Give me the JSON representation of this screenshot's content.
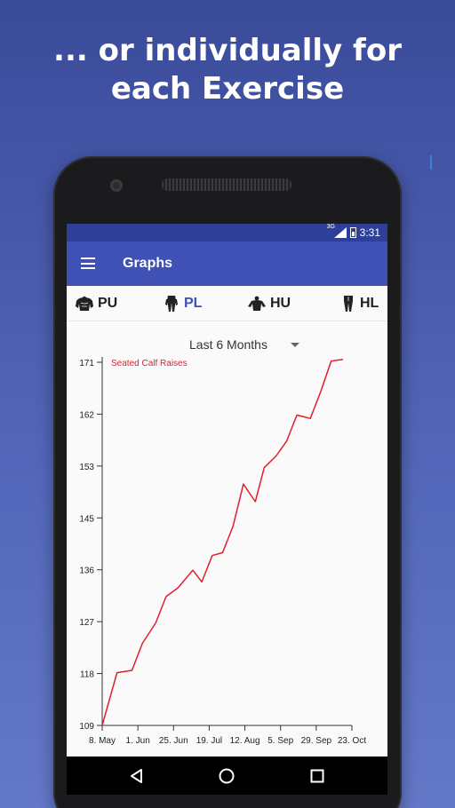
{
  "headline": {
    "line1": "... or individually for",
    "line2": "each Exercise"
  },
  "status": {
    "network": "3G",
    "time": "3:31"
  },
  "appbar": {
    "title": "Graphs"
  },
  "tabs": [
    {
      "label": "PU",
      "icon": "upper-body-front-icon"
    },
    {
      "label": "PL",
      "icon": "lower-body-front-icon",
      "active": true
    },
    {
      "label": "HU",
      "icon": "upper-body-back-icon"
    },
    {
      "label": "HL",
      "icon": "lower-body-back-icon"
    }
  ],
  "range_selector": {
    "value": "Last 6 Months"
  },
  "colors": {
    "accent": "#3f51b5",
    "series": "#e01e2e"
  },
  "chart_data": {
    "type": "line",
    "series": [
      {
        "name": "Seated Calf Raises",
        "x": [
          "2015-05-08",
          "2015-05-18",
          "2015-05-28",
          "2015-06-04",
          "2015-06-13",
          "2015-06-20",
          "2015-06-28",
          "2015-07-08",
          "2015-07-14",
          "2015-07-21",
          "2015-07-28",
          "2015-08-04",
          "2015-08-11",
          "2015-08-19",
          "2015-08-25",
          "2015-09-02",
          "2015-09-09",
          "2015-09-16",
          "2015-09-25",
          "2015-10-02",
          "2015-10-09",
          "2015-10-17"
        ],
        "values": [
          109,
          118,
          118.4,
          123,
          126.5,
          131,
          132.5,
          135.5,
          133.5,
          138,
          138.5,
          143,
          150.2,
          147.2,
          153,
          155,
          157.5,
          162,
          161.4,
          166,
          171.2,
          171.5
        ]
      }
    ],
    "x_ticks": [
      "8. May",
      "1. Jun",
      "25. Jun",
      "19. Jul",
      "12. Aug",
      "5. Sep",
      "29. Sep",
      "23. Oct"
    ],
    "y_ticks": [
      "109",
      "118",
      "127",
      "136",
      "145",
      "153",
      "162",
      "171"
    ],
    "ylim": [
      109,
      171
    ],
    "legend": "top-left",
    "grid": false
  }
}
